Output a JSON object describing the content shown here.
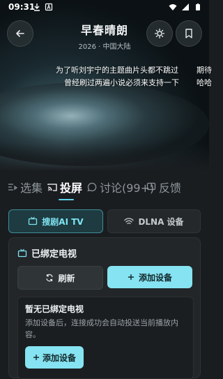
{
  "status_bar": {
    "time": "09:31",
    "icons": [
      "download-icon",
      "notification-a-icon",
      "wifi-icon",
      "signal-icon",
      "battery-icon"
    ]
  },
  "header": {
    "title": "早春晴朗",
    "subtitle": "2026 · 中国大陆"
  },
  "danmaku": [
    "为了听刘宇宁的主题曲片头都不跳过",
    "期待",
    "曾经刷过两遍小说必须来支持一下",
    "哈哈"
  ],
  "tabs": [
    {
      "label": "选集",
      "icon": "episodes-icon",
      "active": false
    },
    {
      "label": "投屏",
      "icon": "cast-icon",
      "active": true
    },
    {
      "label": "讨论(99+)",
      "icon": "comment-icon",
      "active": false
    },
    {
      "label": "反馈",
      "icon": "feedback-icon",
      "active": false
    }
  ],
  "cast": {
    "device_tabs": [
      {
        "label": "搜剧AI TV",
        "icon": "tv-icon",
        "active": true
      },
      {
        "label": "DLNA 设备",
        "icon": "wifi-icon",
        "active": false
      }
    ],
    "bound_title": "已绑定电视",
    "refresh_label": "刷新",
    "add_device_label": "添加设备",
    "empty_title": "暂无已绑定电视",
    "empty_desc": "添加设备后，连接成功会自动投送当前播放内容。",
    "empty_add_label": "添加设备"
  },
  "colors": {
    "accent": "#86e3f1",
    "accent_text": "#7fe3f2",
    "background": "#1a1d20"
  }
}
